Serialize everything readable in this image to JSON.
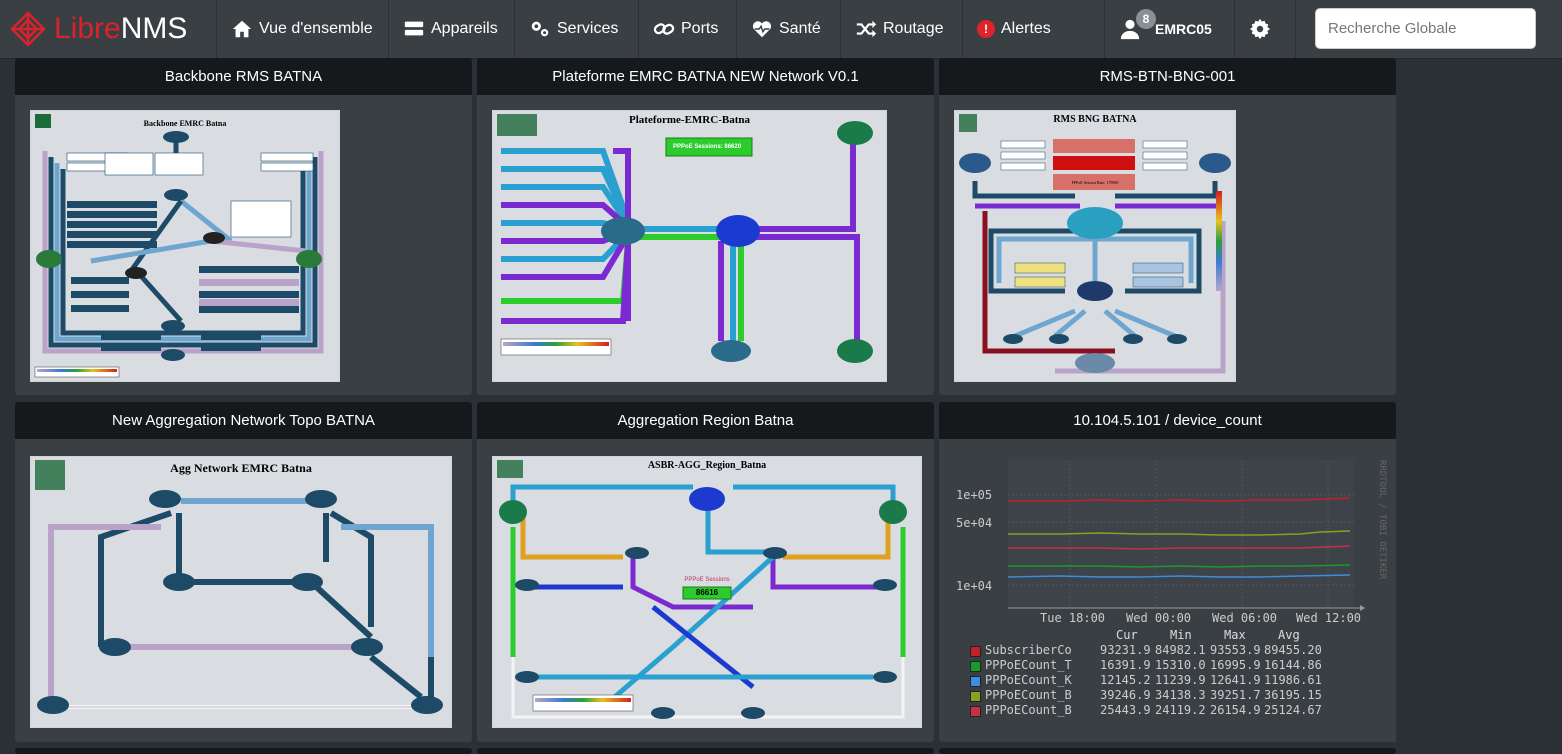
{
  "brand": {
    "part1": "Libre",
    "part2": "NMS"
  },
  "nav": {
    "overview": "Vue d'ensemble",
    "devices": "Appareils",
    "services": "Services",
    "ports": "Ports",
    "health": "Santé",
    "routing": "Routage",
    "alerts": "Alertes",
    "alert_icon": "!",
    "user_count": "8",
    "user": "EMRC05"
  },
  "search": {
    "placeholder": "Recherche Globale"
  },
  "widgets": [
    {
      "title": "Backbone RMS BATNA",
      "map_title": "Backbone EMRC Batna"
    },
    {
      "title": "Plateforme EMRC BATNA NEW Network V0.1",
      "map_title": "Plateforme-EMRC-Batna",
      "badge": "PPPoE Sessions: 86620"
    },
    {
      "title": "RMS-BTN-BNG-001",
      "map_title": "RMS BNG BATNA",
      "box1": "PPPoE Session Rate: 179000"
    },
    {
      "title": "New Aggregation Network Topo BATNA",
      "map_title": "Agg Network EMRC Batna"
    },
    {
      "title": "Aggregation Region Batna",
      "map_title": "ASBR-AGG_Region_Batna",
      "sessions_label": "PPPoE Sessions :",
      "sessions_value": "86616"
    },
    {
      "title": "10.104.5.101 / device_count"
    }
  ],
  "graph": {
    "y_ticks": [
      "1e+05",
      "5e+04",
      "1e+04"
    ],
    "x_ticks": [
      "Tue 18:00",
      "Wed 00:00",
      "Wed 06:00",
      "Wed 12:00"
    ],
    "side_label": "RRDTOOL / TOBI OETIKER",
    "col_headers": [
      "Cur",
      "Min",
      "Max",
      "Avg"
    ],
    "legend": [
      {
        "name": "SubscriberCo",
        "color": "#c0202a",
        "cur": "93231.9",
        "min": "84982.1",
        "max": "93553.9",
        "avg": "89455.20"
      },
      {
        "name": "PPPoECount_T",
        "color": "#1a9a2a",
        "cur": "16391.9",
        "min": "15310.0",
        "max": "16995.9",
        "avg": "16144.86"
      },
      {
        "name": "PPPoECount_K",
        "color": "#3a8ee0",
        "cur": "12145.2",
        "min": "11239.9",
        "max": "12641.9",
        "avg": "11986.61"
      },
      {
        "name": "PPPoECount_B",
        "color": "#8aa020",
        "cur": "39246.9",
        "min": "34138.3",
        "max": "39251.7",
        "avg": "36195.15"
      },
      {
        "name": "PPPoECount_B",
        "color": "#c8304a",
        "cur": "25443.9",
        "min": "24119.2",
        "max": "26154.9",
        "avg": "25124.67"
      }
    ]
  }
}
